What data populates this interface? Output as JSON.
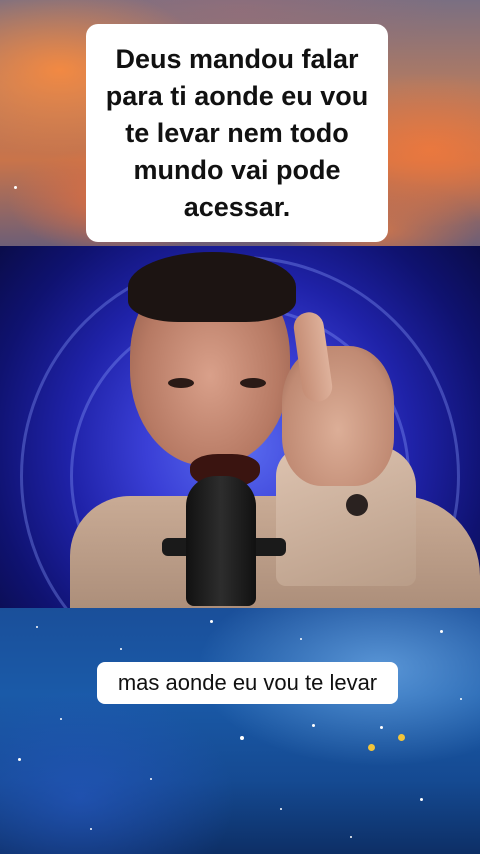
{
  "captions": {
    "top_text": "Deus mandou falar para ti aonde eu vou te levar nem todo mundo vai pode acessar.",
    "bottom_text": "mas aonde eu vou te levar"
  },
  "colors": {
    "caption_background": "#ffffff",
    "caption_text": "#111111",
    "singer_backdrop": "#3a3fd6",
    "sky_sunset": "#c9744a",
    "night_sky": "#1a5aa8"
  }
}
